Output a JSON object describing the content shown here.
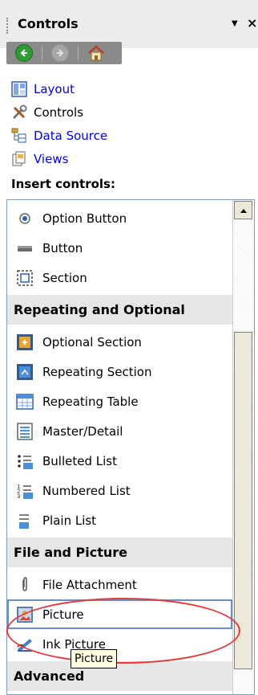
{
  "panel": {
    "title": "Controls",
    "dropdown_glyph": "▼",
    "close_glyph": "×"
  },
  "nav": {
    "back_icon": "back-arrow-icon",
    "forward_icon": "forward-arrow-icon",
    "home_icon": "home-icon"
  },
  "links": [
    {
      "label": "Layout",
      "icon": "layout-icon"
    },
    {
      "label": "Controls",
      "icon": "controls-tools-icon"
    },
    {
      "label": "Data Source",
      "icon": "data-source-icon"
    },
    {
      "label": "Views",
      "icon": "views-icon"
    }
  ],
  "insert_label": "Insert controls:",
  "list": {
    "option_button": "Option Button",
    "button": "Button",
    "section": "Section",
    "cat_repeating": "Repeating and Optional",
    "optional_section": "Optional Section",
    "repeating_section": "Repeating Section",
    "repeating_table": "Repeating Table",
    "master_detail": "Master/Detail",
    "bulleted_list": "Bulleted List",
    "numbered_list": "Numbered List",
    "plain_list": "Plain List",
    "cat_file": "File and Picture",
    "file_attachment": "File Attachment",
    "picture": "Picture",
    "ink_picture": "Ink Picture",
    "cat_advanced": "Advanced"
  },
  "tooltip": "Picture",
  "colors": {
    "link": "#0000ee",
    "category_bg": "#e6e6e6",
    "annotation": "#e23a3a",
    "tooltip_bg": "#ffffe1"
  }
}
